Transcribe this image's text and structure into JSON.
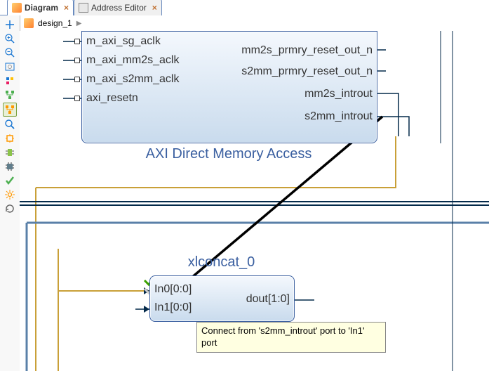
{
  "tabs": {
    "diagram": "Diagram",
    "address_editor": "Address Editor"
  },
  "breadcrumb": {
    "design_name": "design_1"
  },
  "blocks": {
    "dma": {
      "label": "AXI Direct Memory Access",
      "ports_left": [
        "m_axi_sg_aclk",
        "m_axi_mm2s_aclk",
        "m_axi_s2mm_aclk",
        "axi_resetn"
      ],
      "ports_right": [
        "mm2s_prmry_reset_out_n",
        "s2mm_prmry_reset_out_n",
        "mm2s_introut",
        "s2mm_introut"
      ]
    },
    "concat": {
      "instance": "xlconcat_0",
      "ports_left": [
        "In0[0:0]",
        "In1[0:0]"
      ],
      "ports_right": [
        "dout[1:0]"
      ]
    }
  },
  "tooltip": {
    "text": "Connect from 's2mm_introut' port to 'In1' port"
  },
  "icons": {
    "diagram_tab": "diagram-icon",
    "addr_tab": "address-editor-icon"
  },
  "colors": {
    "accent_blue": "#3a5fa0",
    "wire_dark": "#042a4a",
    "wire_gold": "#c9a038",
    "block_top": "#f4f8fd",
    "block_bot": "#c9dbed",
    "tooltip_bg": "#ffffe1"
  }
}
